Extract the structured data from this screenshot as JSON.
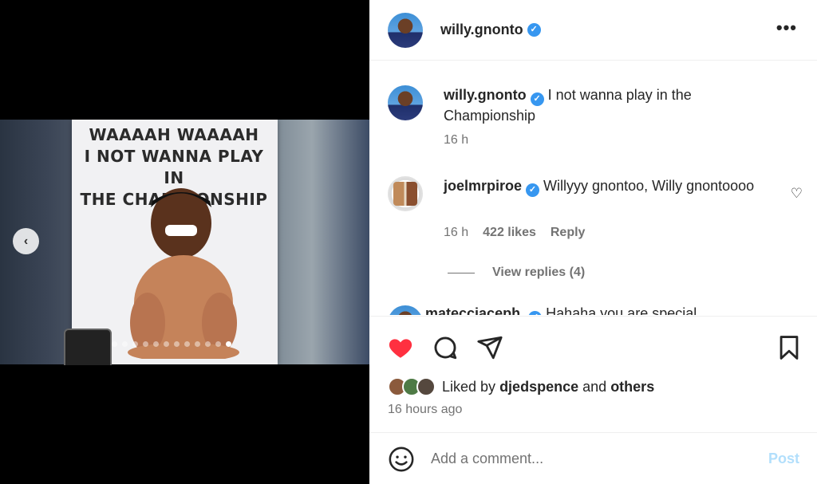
{
  "post": {
    "author": "willy.gnonto",
    "banner_lines": [
      "WAAAAH WAAAAH",
      "I NOT WANNA PLAY IN",
      "THE CHAMPIONSHIP"
    ],
    "carousel": {
      "count": 12,
      "active_index": 11
    }
  },
  "header": {
    "username": "willy.gnonto",
    "more_label": "•••"
  },
  "comments": [
    {
      "username": "willy.gnonto",
      "text": "I not wanna play in the Championship",
      "time": "16 h"
    },
    {
      "username": "joelmrpiroe",
      "text": "Willyyy gnontoo, Willy gnontoooo",
      "time": "16 h",
      "likes": "422 likes",
      "reply_label": "Reply",
      "view_replies": "View replies (4)"
    },
    {
      "username_partial": "matecciaceph",
      "text_partial": "Hahaha you are special"
    }
  ],
  "actions": {
    "liked_by_prefix": "Liked by",
    "liked_by_user": "djedspence",
    "liked_by_and": "and",
    "liked_by_others": "others",
    "timestamp": "16 hours ago"
  },
  "comment_box": {
    "placeholder": "Add a comment...",
    "post_label": "Post"
  },
  "colors": {
    "like_red": "#ff3040",
    "verified_blue": "#3797f0",
    "post_disabled": "#b2dffc"
  }
}
